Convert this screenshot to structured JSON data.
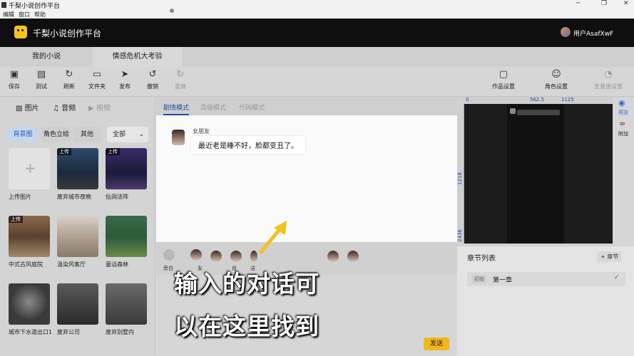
{
  "window": {
    "title": "千梨小说创作平台",
    "menu": [
      "编辑",
      "窗口",
      "帮助"
    ]
  },
  "header": {
    "app_name": "千梨小说创作平台",
    "user_name": "用户AsafXwF"
  },
  "tabs": [
    {
      "label": "我的小说"
    },
    {
      "label": "情感危机大考验"
    }
  ],
  "toolbar": {
    "left": [
      {
        "label": "保存",
        "icon": "save-icon"
      },
      {
        "label": "测试",
        "icon": "test-icon"
      },
      {
        "label": "刷新",
        "icon": "refresh-icon"
      },
      {
        "label": "文件夹",
        "icon": "folder-icon"
      },
      {
        "label": "发布",
        "icon": "publish-icon"
      },
      {
        "label": "撤销",
        "icon": "undo-icon"
      },
      {
        "label": "重做",
        "icon": "redo-icon"
      }
    ],
    "right": [
      {
        "label": "作品设置",
        "icon": "work-settings-icon"
      },
      {
        "label": "角色设置",
        "icon": "character-settings-icon"
      },
      {
        "label": "变量值设置",
        "icon": "gauge-icon"
      }
    ]
  },
  "media": {
    "tabs": [
      "图片",
      "音频",
      "视频"
    ],
    "subtabs": [
      "背景图",
      "角色立绘",
      "其他"
    ],
    "filter": "全部",
    "badge": "上传",
    "items": [
      {
        "caption": "上传图片"
      },
      {
        "caption": "废弃城市夜晚"
      },
      {
        "caption": "仙洞法阵"
      },
      {
        "caption": "中式古风庭院"
      },
      {
        "caption": "温染风客厅"
      },
      {
        "caption": "童话森林"
      },
      {
        "caption": "城市下水道出口1"
      },
      {
        "caption": "废弃公司"
      },
      {
        "caption": "废弃别墅内"
      }
    ]
  },
  "editor": {
    "modes": [
      "剧情模式",
      "高级模式",
      "代码模式"
    ],
    "speaker": "女朋友",
    "line": "最近老是睡不好，脸都变丑了。",
    "char_labels": [
      "旁白",
      "友",
      "",
      "肖",
      "洁"
    ],
    "send_label": "发送"
  },
  "overlay": {
    "caption_line1": "输入的对话可",
    "caption_line2": "以在这里找到"
  },
  "preview": {
    "ruler_top": [
      "562.5",
      "1125"
    ],
    "ruler_side": [
      "0",
      "1218",
      "2436"
    ],
    "side_buttons": [
      "预览",
      "附加"
    ]
  },
  "chapters": {
    "title": "章节列表",
    "add_label": "+ 章节",
    "items": [
      {
        "tag": "初始",
        "name": "第一章"
      }
    ]
  },
  "colors": {
    "accent": "#f2b61a",
    "header_bg": "#0f0f0f",
    "link_blue": "#2a6ad0"
  }
}
